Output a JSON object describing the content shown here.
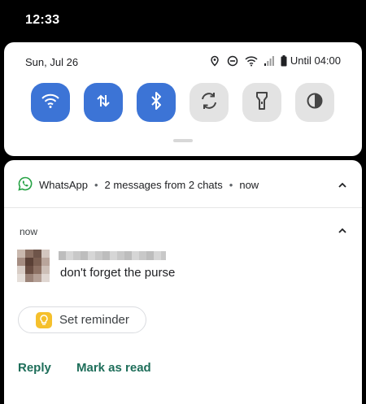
{
  "status_bar": {
    "time": "12:33"
  },
  "quick_settings": {
    "date": "Sun, Jul 26",
    "battery_text": "Until 04:00",
    "status_icons": [
      "location-icon",
      "dnd-icon",
      "wifi-signal-icon",
      "cell-signal-icon",
      "battery-icon"
    ],
    "tiles": [
      {
        "icon": "wifi-icon",
        "state": "on"
      },
      {
        "icon": "mobile-data-icon",
        "state": "on"
      },
      {
        "icon": "bluetooth-icon",
        "state": "on"
      },
      {
        "icon": "auto-rotate-icon",
        "state": "off"
      },
      {
        "icon": "flashlight-icon",
        "state": "off"
      },
      {
        "icon": "invert-colors-icon",
        "state": "off"
      }
    ],
    "colors": {
      "tile_on": "#3c74d6",
      "tile_off": "#e3e3e3"
    }
  },
  "notification": {
    "app_name": "WhatsApp",
    "separator": "•",
    "summary": "2 messages from 2 chats",
    "summary_time": "now",
    "message_time": "now",
    "message_text": "don't forget the purse",
    "chip_label": "Set reminder",
    "actions": {
      "reply": "Reply",
      "mark_read": "Mark as read"
    },
    "colors": {
      "whatsapp": "#25a244",
      "action_text": "#1e6e5a",
      "chip_icon": "#f5c02c"
    }
  }
}
